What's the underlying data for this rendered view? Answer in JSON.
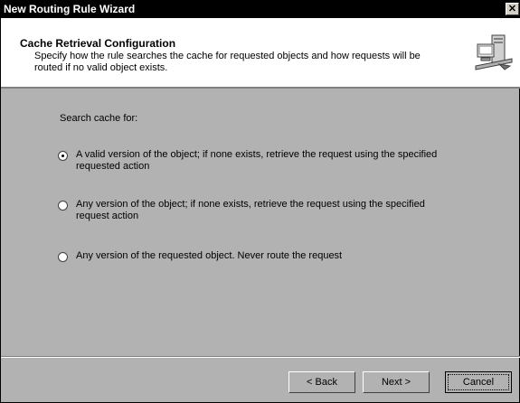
{
  "window": {
    "title": "New Routing Rule Wizard",
    "close_label": "✕"
  },
  "header": {
    "title": "Cache Retrieval Configuration",
    "description": "Specify how the rule searches the cache for requested objects and how requests will be routed if no valid object exists.",
    "icon": "wizard-computer-icon"
  },
  "content": {
    "search_label": "Search cache for:",
    "options": [
      {
        "label": "A valid version of the object; if none exists, retrieve the request using the specified requested action",
        "selected": true
      },
      {
        "label": "Any version of the object; if none exists, retrieve the request using the specified request action",
        "selected": false
      },
      {
        "label": "Any version of the requested object. Never route the request",
        "selected": false
      }
    ]
  },
  "footer": {
    "back_label": "< Back",
    "next_label": "Next >",
    "cancel_label": "Cancel"
  }
}
